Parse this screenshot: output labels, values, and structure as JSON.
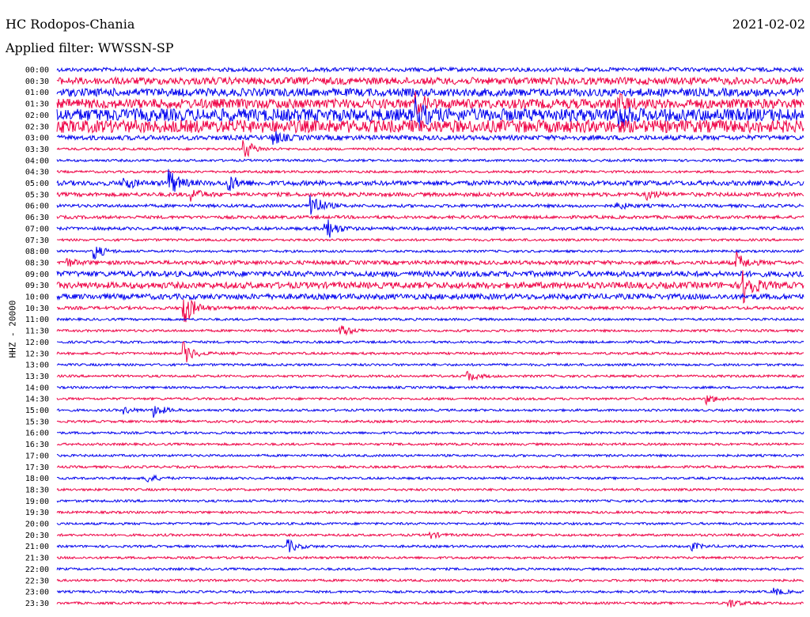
{
  "header": {
    "station": "HC Rodopos-Chania",
    "date": "2021-02-02",
    "filter": "Applied filter: WWSSN-SP"
  },
  "chart_data": {
    "type": "line",
    "title": "HC Rodopos-Chania",
    "subtitle": "Applied filter: WWSSN-SP",
    "ylabel": "HHZ - 20000",
    "colors": [
      "#0000ee",
      "#ee0044"
    ],
    "row_labels": [
      "00:00",
      "00:30",
      "01:00",
      "01:30",
      "02:00",
      "02:30",
      "03:00",
      "03:30",
      "04:00",
      "04:30",
      "05:00",
      "05:30",
      "06:00",
      "06:30",
      "07:00",
      "07:30",
      "08:00",
      "08:30",
      "09:00",
      "09:30",
      "10:00",
      "10:30",
      "11:00",
      "11:30",
      "12:00",
      "12:30",
      "13:00",
      "13:30",
      "14:00",
      "14:30",
      "15:00",
      "15:30",
      "16:00",
      "16:30",
      "17:00",
      "17:30",
      "18:00",
      "18:30",
      "19:00",
      "19:30",
      "20:00",
      "20:30",
      "21:00",
      "21:30",
      "22:00",
      "22:30",
      "23:00",
      "23:30"
    ],
    "noise_level": [
      2.5,
      4.5,
      5,
      6,
      8,
      8,
      3,
      1.5,
      1.5,
      1.5,
      3,
      2.5,
      2,
      2,
      2,
      1.5,
      1.5,
      2.5,
      3.5,
      4,
      3.5,
      2,
      1.5,
      1.5,
      1.5,
      1.5,
      1.5,
      1.5,
      1.5,
      1.5,
      1.5,
      1.5,
      1.5,
      1.5,
      1.5,
      1.5,
      1.5,
      1.5,
      1.5,
      1.5,
      1.5,
      1.5,
      1.5,
      1.5,
      1.5,
      1.5,
      1.5,
      1.5
    ],
    "events": [
      {
        "row": 3,
        "t": 0.48,
        "amp": 12
      },
      {
        "row": 3,
        "t": 0.75,
        "amp": 12
      },
      {
        "row": 4,
        "t": 0.48,
        "amp": 18
      },
      {
        "row": 4,
        "t": 0.75,
        "amp": 16
      },
      {
        "row": 6,
        "t": 0.29,
        "amp": 8
      },
      {
        "row": 7,
        "t": 0.25,
        "amp": 14
      },
      {
        "row": 10,
        "t": 0.09,
        "amp": 8
      },
      {
        "row": 10,
        "t": 0.15,
        "amp": 18
      },
      {
        "row": 10,
        "t": 0.23,
        "amp": 10
      },
      {
        "row": 11,
        "t": 0.18,
        "amp": 8
      },
      {
        "row": 11,
        "t": 0.79,
        "amp": 6
      },
      {
        "row": 12,
        "t": 0.34,
        "amp": 20
      },
      {
        "row": 12,
        "t": 0.75,
        "amp": 5
      },
      {
        "row": 14,
        "t": 0.36,
        "amp": 16
      },
      {
        "row": 16,
        "t": 0.05,
        "amp": 10
      },
      {
        "row": 17,
        "t": 0.01,
        "amp": 6
      },
      {
        "row": 17,
        "t": 0.91,
        "amp": 12
      },
      {
        "row": 19,
        "t": 0.92,
        "amp": 22
      },
      {
        "row": 21,
        "t": 0.17,
        "amp": 24
      },
      {
        "row": 23,
        "t": 0.38,
        "amp": 8
      },
      {
        "row": 25,
        "t": 0.17,
        "amp": 14
      },
      {
        "row": 27,
        "t": 0.55,
        "amp": 7
      },
      {
        "row": 29,
        "t": 0.87,
        "amp": 6
      },
      {
        "row": 30,
        "t": 0.13,
        "amp": 9
      },
      {
        "row": 30,
        "t": 0.09,
        "amp": 4
      },
      {
        "row": 36,
        "t": 0.12,
        "amp": 6
      },
      {
        "row": 41,
        "t": 0.5,
        "amp": 4
      },
      {
        "row": 42,
        "t": 0.31,
        "amp": 8
      },
      {
        "row": 42,
        "t": 0.85,
        "amp": 5
      },
      {
        "row": 46,
        "t": 0.96,
        "amp": 5
      },
      {
        "row": 47,
        "t": 0.9,
        "amp": 6
      }
    ]
  }
}
